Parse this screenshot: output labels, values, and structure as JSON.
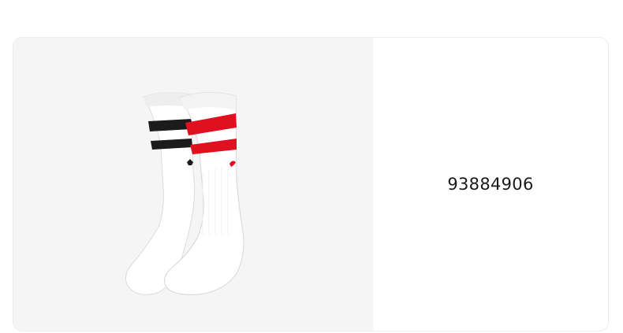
{
  "product": {
    "code": "93884906",
    "image_icon": "socks-pair-image",
    "colors": {
      "sock_body": "#ffffff",
      "sock_shadow": "#e6e6e6",
      "left_stripes": "#1b1b1b",
      "right_stripes": "#e01020",
      "panel_background": "#f5f5f5"
    }
  }
}
